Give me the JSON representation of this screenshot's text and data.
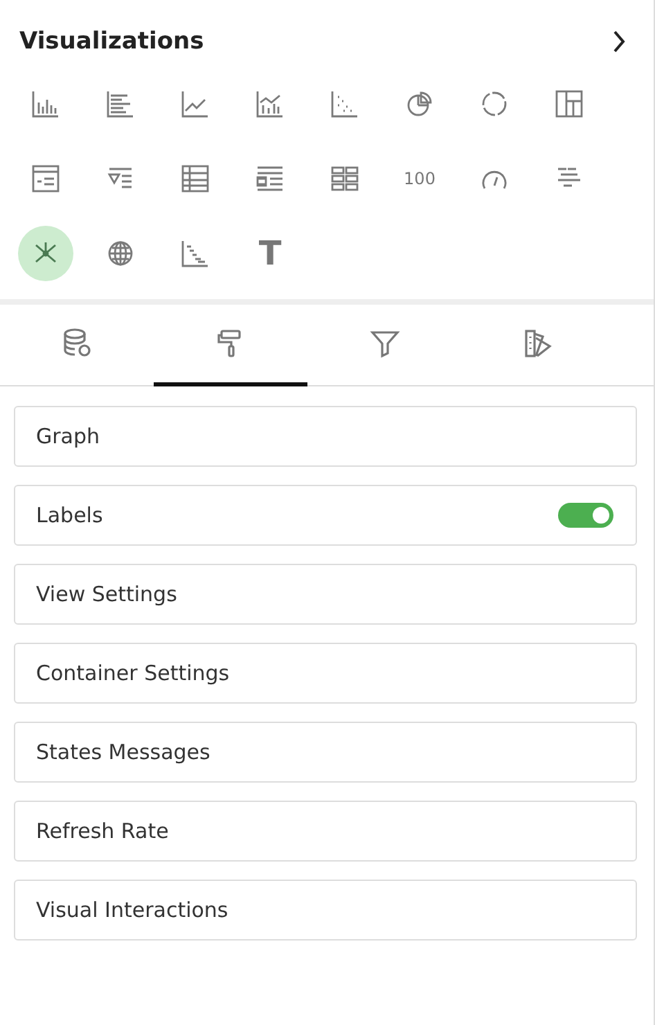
{
  "visualizations": {
    "title": "Visualizations",
    "items": [
      {
        "kind": "column",
        "selected": false
      },
      {
        "kind": "bar",
        "selected": false
      },
      {
        "kind": "line",
        "selected": false
      },
      {
        "kind": "combo",
        "selected": false
      },
      {
        "kind": "scatter",
        "selected": false
      },
      {
        "kind": "pie",
        "selected": false
      },
      {
        "kind": "donut",
        "selected": false
      },
      {
        "kind": "layout",
        "selected": false
      },
      {
        "kind": "form",
        "selected": false
      },
      {
        "kind": "filterlist",
        "selected": false
      },
      {
        "kind": "table",
        "selected": false
      },
      {
        "kind": "list",
        "selected": false
      },
      {
        "kind": "cards",
        "selected": false
      },
      {
        "kind": "number",
        "label": "100",
        "selected": false
      },
      {
        "kind": "gauge",
        "selected": false
      },
      {
        "kind": "gantt",
        "selected": false
      },
      {
        "kind": "network",
        "selected": true
      },
      {
        "kind": "globe",
        "selected": false
      },
      {
        "kind": "waterfall",
        "selected": false
      },
      {
        "kind": "text",
        "label": "T",
        "selected": false
      }
    ]
  },
  "tabs": [
    {
      "kind": "data",
      "selected": false
    },
    {
      "kind": "format",
      "selected": true
    },
    {
      "kind": "filter",
      "selected": false
    },
    {
      "kind": "palette",
      "selected": false
    }
  ],
  "sections": [
    {
      "kind": "plain",
      "label": "Graph"
    },
    {
      "kind": "toggle",
      "label": "Labels",
      "on": true
    },
    {
      "kind": "plain",
      "label": "View Settings"
    },
    {
      "kind": "plain",
      "label": "Container Settings"
    },
    {
      "kind": "plain",
      "label": "States Messages"
    },
    {
      "kind": "plain",
      "label": "Refresh Rate"
    },
    {
      "kind": "plain",
      "label": "Visual Interactions"
    }
  ]
}
